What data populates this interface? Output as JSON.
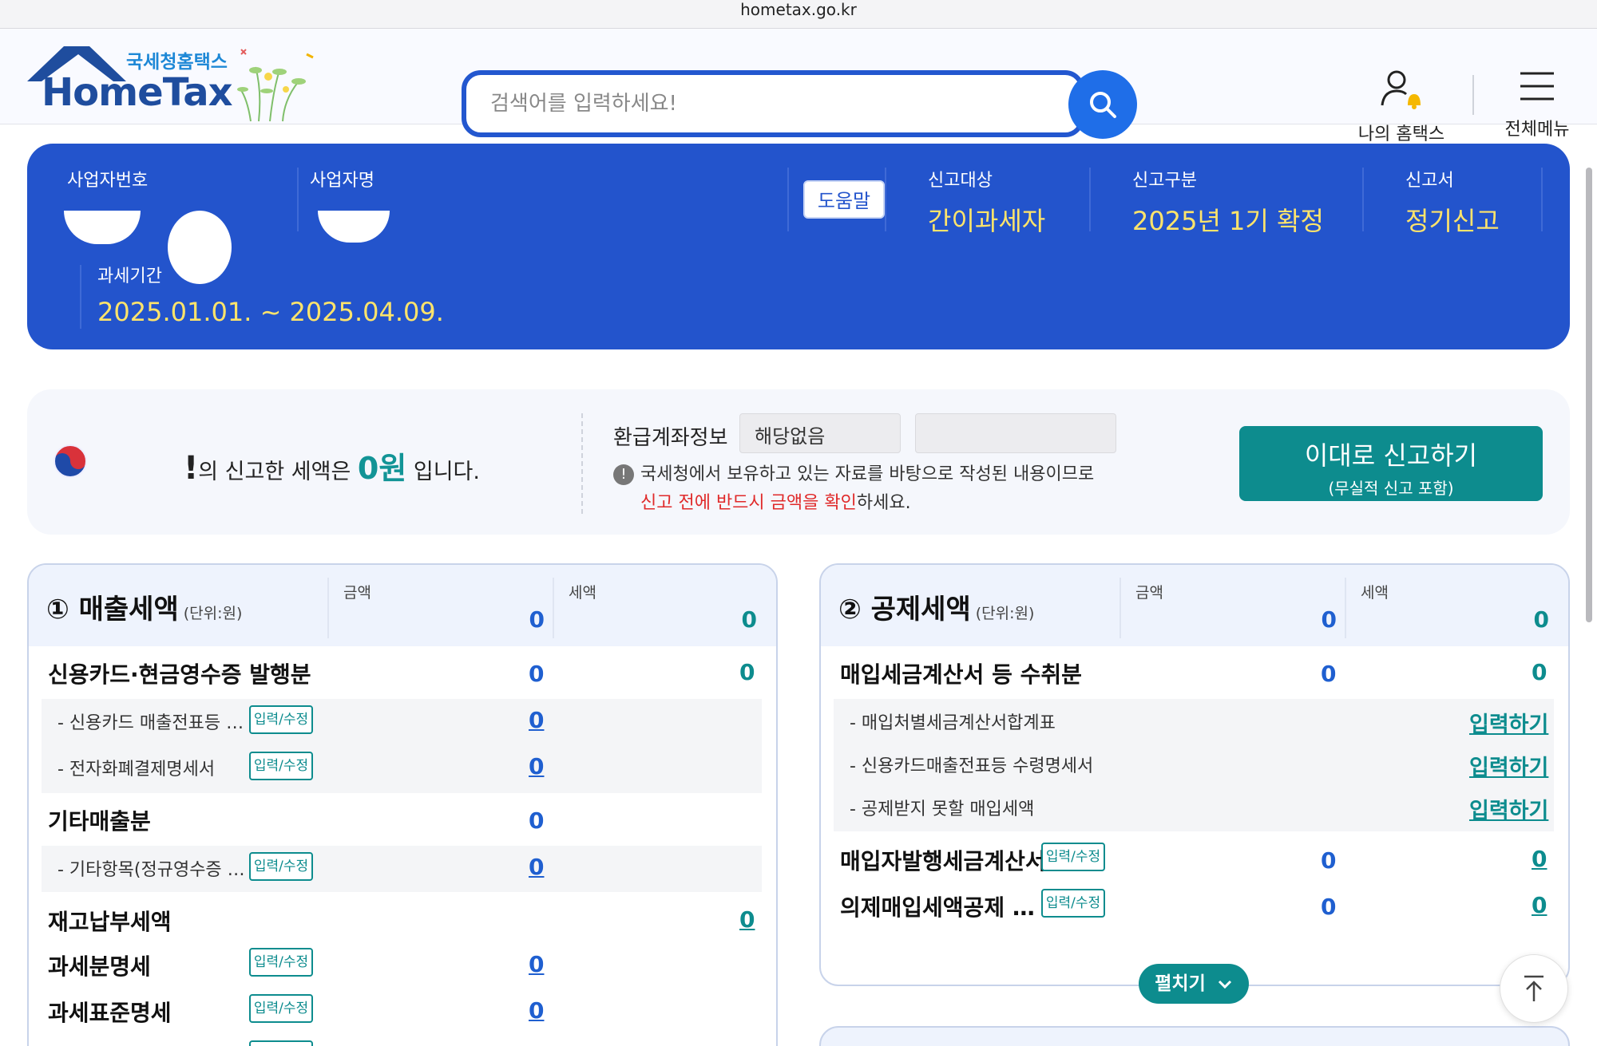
{
  "browser": {
    "url": "hometax.go.kr"
  },
  "header": {
    "logo_sub": "국세청홈택스",
    "logo_main": "HomeTax",
    "search_placeholder": "검색어를 입력하세요!",
    "my_hometax": "나의 홈택스",
    "all_menu": "전체메뉴"
  },
  "info_panel": {
    "biz_no_label": "사업자번호",
    "biz_name_label": "사업자명",
    "help_label": "도움말",
    "target_label": "신고대상",
    "target_value": "간이과세자",
    "category_label": "신고구분",
    "category_value": "2025년 1기 확정",
    "form_label": "신고서",
    "form_value": "정기신고",
    "period_label": "과세기간",
    "period_value": "2025.01.01. ~ 2025.04.09."
  },
  "summary": {
    "bang": "!",
    "text_pre": "의 신고한 세액은 ",
    "amount": "0원",
    "text_post": " 입니다.",
    "refund_label": "환급계좌정보",
    "refund_value": "해당없음",
    "notice_icon": "!",
    "notice_line1": "국세청에서 보유하고 있는 자료를 바탕으로 작성된 내용이므로",
    "notice_red": "신고 전에 반드시 금액을 확인",
    "notice_tail": "하세요.",
    "file_button": "이대로 신고하기",
    "file_button_sub": "(무실적 신고 포함)"
  },
  "sales": {
    "title": "① 매출세액",
    "unit": "(단위:원)",
    "amount_label": "금액",
    "amount_value": "0",
    "tax_label": "세액",
    "tax_value": "0",
    "edit_label": "입력/수정",
    "card_row": {
      "label": "신용카드·현금영수증 발행분",
      "amount": "0",
      "tax": "0"
    },
    "card_sub1": {
      "label": "- 신용카드 매출전표등 …",
      "amount": "0"
    },
    "card_sub2": {
      "label": "- 전자화폐결제명세서",
      "amount": "0"
    },
    "etc_row": {
      "label": "기타매출분",
      "amount": "0"
    },
    "etc_sub1": {
      "label": "- 기타항목(정규영수증 …",
      "amount": "0"
    },
    "inventory_row": {
      "label": "재고납부세액",
      "tax": "0"
    },
    "taxable_detail": {
      "label": "과세분명세",
      "amount": "0"
    },
    "tax_std_detail": {
      "label": "과세표준명세",
      "amount": "0"
    }
  },
  "deduction": {
    "title": "② 공제세액",
    "unit": "(단위:원)",
    "amount_label": "금액",
    "amount_value": "0",
    "tax_label": "세액",
    "tax_value": "0",
    "edit_label": "입력/수정",
    "input_link": "입력하기",
    "invoice_row": {
      "label": "매입세금계산서 등 수취분",
      "amount": "0",
      "tax": "0"
    },
    "sub1": "- 매입처별세금계산서합계표",
    "sub2": "- 신용카드매출전표등 수령명세서",
    "sub3": "- 공제받지 못할 매입세액",
    "buyer_row": {
      "label": "매입자발행세금계산서",
      "amount": "0",
      "tax": "0"
    },
    "deemed_row": {
      "label": "의제매입세액공제 …",
      "amount": "0",
      "tax": "0"
    },
    "expand_label": "펼치기"
  },
  "colors": {
    "primary_blue": "#2354cc",
    "teal": "#0d8c8e",
    "highlight_yellow": "#ffe46b",
    "red": "#e02a2a"
  }
}
